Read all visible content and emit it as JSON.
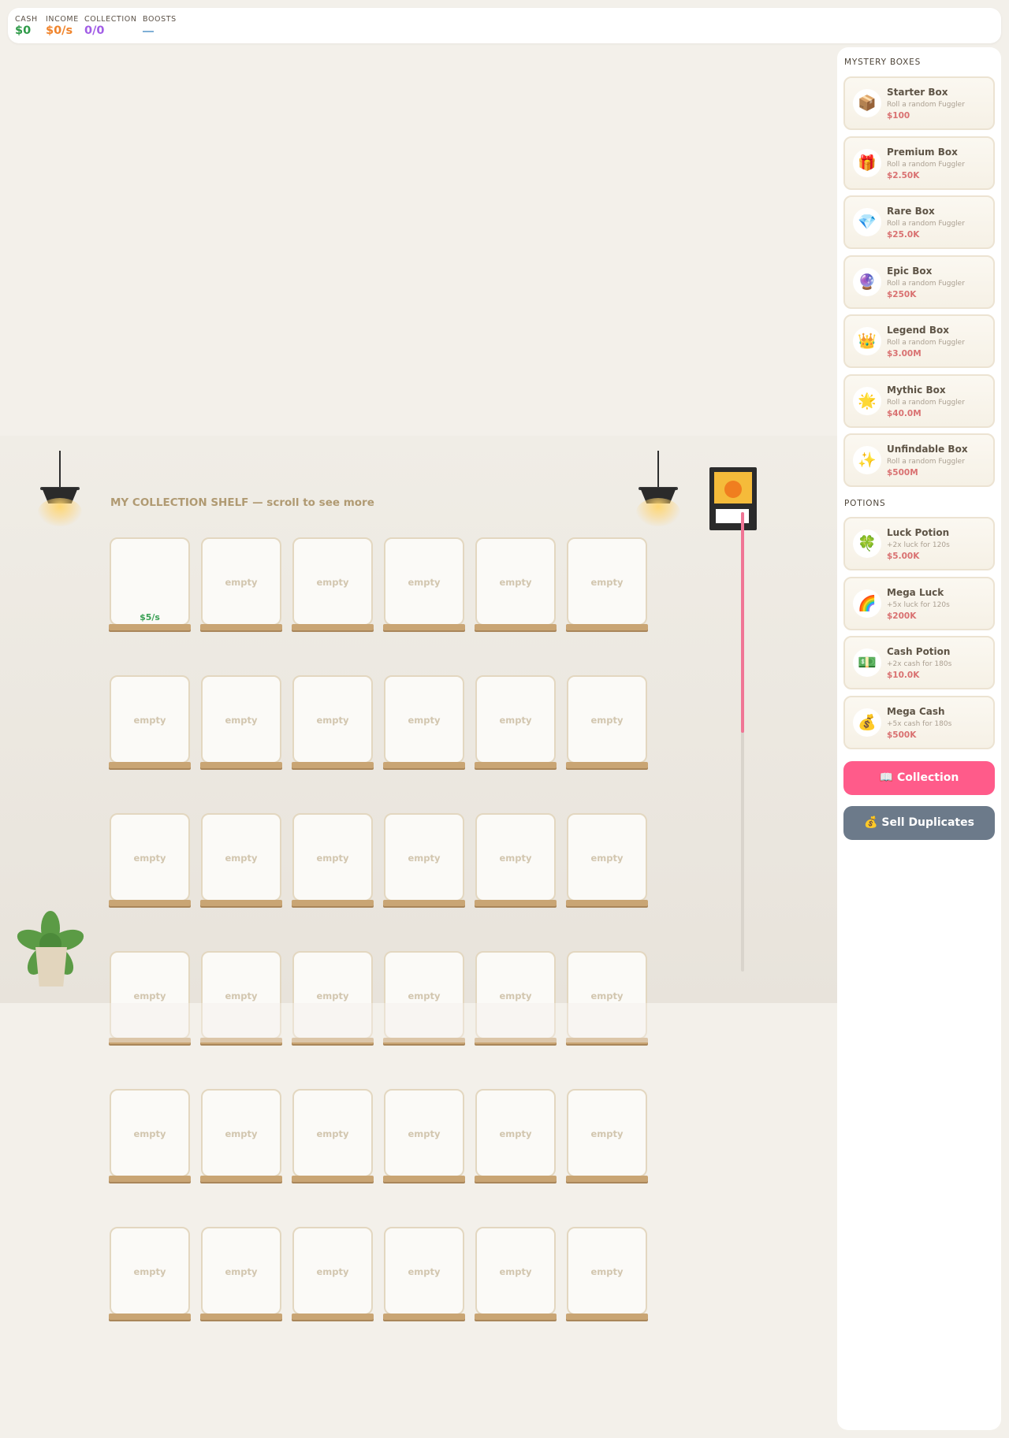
{
  "stats": {
    "cash_label": "CASH",
    "cash_value": "$0",
    "income_label": "INCOME",
    "income_value": "$0/s",
    "collection_label": "COLLECTION",
    "collection_value": "0/0",
    "boosts_label": "BOOSTS"
  },
  "colors": {
    "cash": "#2e9a48",
    "income": "#f0842c",
    "collection": "#a25ee6",
    "collection_button": "#ff5b8a",
    "sell_button": "#6c7a8a",
    "price": "#d97171"
  },
  "shelf": {
    "title": "MY COLLECTION SHELF — scroll to see more",
    "empty_label": "empty",
    "first_slot_rate": "$5/s",
    "rows": 6,
    "columns": 6,
    "progress_fill_fraction": 0.48
  },
  "sidebar": {
    "mystery_title": "MYSTERY BOXES",
    "boxes": [
      {
        "icon": "box-icon",
        "glyph": "📦",
        "name": "Starter Box",
        "desc": "Roll a random Fuggler",
        "price": "$100"
      },
      {
        "icon": "gift-icon",
        "glyph": "🎁",
        "name": "Premium Box",
        "desc": "Roll a random Fuggler",
        "price": "$2.50K"
      },
      {
        "icon": "gem-icon",
        "glyph": "💎",
        "name": "Rare Box",
        "desc": "Roll a random Fuggler",
        "price": "$25.0K"
      },
      {
        "icon": "crystal-ball-icon",
        "glyph": "🔮",
        "name": "Epic Box",
        "desc": "Roll a random Fuggler",
        "price": "$250K"
      },
      {
        "icon": "crown-icon",
        "glyph": "👑",
        "name": "Legend Box",
        "desc": "Roll a random Fuggler",
        "price": "$3.00M"
      },
      {
        "icon": "star-icon",
        "glyph": "🌟",
        "name": "Mythic Box",
        "desc": "Roll a random Fuggler",
        "price": "$40.0M"
      },
      {
        "icon": "sparkles-icon",
        "glyph": "✨",
        "name": "Unfindable Box",
        "desc": "Roll a random Fuggler",
        "price": "$500M"
      }
    ],
    "potions_title": "POTIONS",
    "potions": [
      {
        "icon": "clover-icon",
        "glyph": "🍀",
        "name": "Luck Potion",
        "desc": "+2x luck for 120s",
        "price": "$5.00K"
      },
      {
        "icon": "rainbow-icon",
        "glyph": "🌈",
        "name": "Mega Luck",
        "desc": "+5x luck for 120s",
        "price": "$200K"
      },
      {
        "icon": "cash-icon",
        "glyph": "💵",
        "name": "Cash Potion",
        "desc": "+2x cash for 180s",
        "price": "$10.0K"
      },
      {
        "icon": "money-bag-icon",
        "glyph": "💰",
        "name": "Mega Cash",
        "desc": "+5x cash for 180s",
        "price": "$500K"
      }
    ],
    "collection_button": {
      "icon": "book-icon",
      "glyph": "📖",
      "label": "Collection"
    },
    "sell_button": {
      "icon": "money-bag-icon",
      "glyph": "💰",
      "label": "Sell Duplicates"
    }
  }
}
